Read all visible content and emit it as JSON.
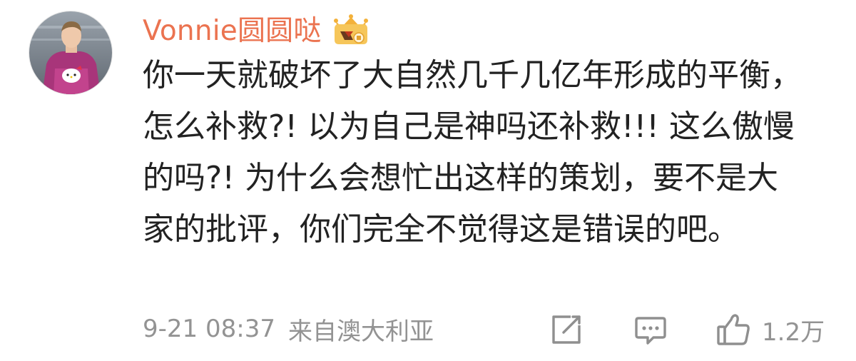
{
  "comment": {
    "username": "Vonnie圆圆哒",
    "badge_icon": "vip-crown-icon",
    "text": "你一天就破坏了大自然几千几亿年形成的平衡，怎么补救?! 以为自己是神吗还补救!!! 这么傲慢的吗?! 为什么会想忙出这样的策划，要不是大家的批评，你们完全不觉得这是错误的吧。",
    "timestamp": "9-21 08:37",
    "source": "来自澳大利亚",
    "like_count": "1.2万"
  },
  "actions": {
    "repost_icon": "repost-icon",
    "reply_icon": "comment-icon",
    "like_icon": "thumbs-up-icon"
  },
  "colors": {
    "username": "#eb7350",
    "text": "#222222",
    "meta": "#939393",
    "icon": "#8f8f8f"
  }
}
